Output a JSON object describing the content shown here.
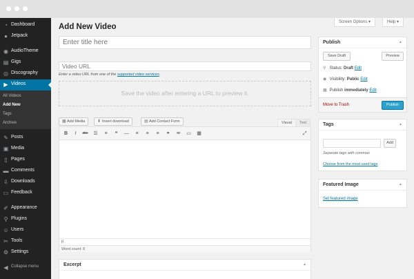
{
  "sidebar": {
    "items": [
      {
        "name": "dashboard",
        "label": "Dashboard",
        "icon": "dashboard-icon",
        "glyph": "◔"
      },
      {
        "name": "jetpack",
        "label": "Jetpack",
        "icon": "jetpack-icon",
        "glyph": "●"
      },
      {
        "name": "audiotheme",
        "label": "AudioTheme",
        "icon": "audiotheme-icon",
        "glyph": "◉"
      },
      {
        "name": "gigs",
        "label": "Gigs",
        "icon": "gigs-icon",
        "glyph": "▤"
      },
      {
        "name": "discography",
        "label": "Discography",
        "icon": "discography-icon",
        "glyph": "◎"
      },
      {
        "name": "videos",
        "label": "Videos",
        "icon": "videos-icon",
        "glyph": "▶"
      },
      {
        "name": "posts",
        "label": "Posts",
        "icon": "posts-icon",
        "glyph": "✎"
      },
      {
        "name": "media",
        "label": "Media",
        "icon": "media-icon",
        "glyph": "▣"
      },
      {
        "name": "pages",
        "label": "Pages",
        "icon": "pages-icon",
        "glyph": "▯"
      },
      {
        "name": "comments",
        "label": "Comments",
        "icon": "comments-icon",
        "glyph": "▬"
      },
      {
        "name": "downloads",
        "label": "Downloads",
        "icon": "downloads-icon",
        "glyph": "⇩"
      },
      {
        "name": "feedback",
        "label": "Feedback",
        "icon": "feedback-icon",
        "glyph": "▭"
      },
      {
        "name": "appearance",
        "label": "Appearance",
        "icon": "appearance-icon",
        "glyph": "✐"
      },
      {
        "name": "plugins",
        "label": "Plugins",
        "icon": "plugins-icon",
        "glyph": "⚲"
      },
      {
        "name": "users",
        "label": "Users",
        "icon": "users-icon",
        "glyph": "☺"
      },
      {
        "name": "tools",
        "label": "Tools",
        "icon": "tools-icon",
        "glyph": "✂"
      },
      {
        "name": "settings",
        "label": "Settings",
        "icon": "settings-icon",
        "glyph": "⚙"
      }
    ],
    "submenu": [
      "All Videos",
      "Add New",
      "Tags",
      "Archive"
    ],
    "collapse": {
      "label": "Collapse menu",
      "glyph": "◀"
    }
  },
  "header": {
    "screen_options": "Screen Options ▾",
    "help": "Help ▾",
    "title": "Add New Video"
  },
  "editor": {
    "title_placeholder": "Enter title here",
    "url_placeholder": "Video URL",
    "url_help_prefix": "Enter a video URL from one of the",
    "url_help_link": "supported video services",
    "url_help_suffix": ".",
    "preview_message": "Save the video after entering a URL to preview it.",
    "buttons": [
      {
        "name": "add-media-button",
        "label": "Add Media",
        "glyph": "▦"
      },
      {
        "name": "insert-download-button",
        "label": "Insert download",
        "glyph": "⬇"
      },
      {
        "name": "add-contact-form-button",
        "label": "Add Contact Form",
        "glyph": "▤"
      }
    ],
    "tabs": {
      "visual": "Visual",
      "text": "Text"
    },
    "toolbar": [
      {
        "name": "bold-icon",
        "glyph": "B"
      },
      {
        "name": "italic-icon",
        "glyph": "I"
      },
      {
        "name": "strikethrough-icon",
        "glyph": "abc"
      },
      {
        "name": "bullet-list-icon",
        "glyph": "☰"
      },
      {
        "name": "numbered-list-icon",
        "glyph": "≡"
      },
      {
        "name": "blockquote-icon",
        "glyph": "❝"
      },
      {
        "name": "horizontal-rule-icon",
        "glyph": "—"
      },
      {
        "name": "align-left-icon",
        "glyph": "≡"
      },
      {
        "name": "align-center-icon",
        "glyph": "≡"
      },
      {
        "name": "align-right-icon",
        "glyph": "≡"
      },
      {
        "name": "insert-link-icon",
        "glyph": "⚭"
      },
      {
        "name": "remove-link-icon",
        "glyph": "⚮"
      },
      {
        "name": "read-more-icon",
        "glyph": "▭"
      },
      {
        "name": "toolbar-toggle-icon",
        "glyph": "▦"
      },
      {
        "name": "fullscreen-icon",
        "glyph": "⤢"
      }
    ],
    "path": "p",
    "word_count": "Word count: 0"
  },
  "excerpt": {
    "title": "Excerpt"
  },
  "publish": {
    "title": "Publish",
    "save_draft": "Save Draft",
    "preview": "Preview",
    "status_label": "Status:",
    "status_value": "Draft",
    "visibility_label": "Visibility:",
    "visibility_value": "Public",
    "publish_label": "Publish",
    "publish_value": "immediately",
    "edit": "Edit",
    "move_to_trash": "Move to Trash",
    "publish_button": "Publish"
  },
  "tags": {
    "title": "Tags",
    "add": "Add",
    "help": "Separate tags with commas",
    "choose": "Choose from the most used tags"
  },
  "featured_image": {
    "title": "Featured Image",
    "link": "Set featured image"
  },
  "toggle_glyph": "▲"
}
